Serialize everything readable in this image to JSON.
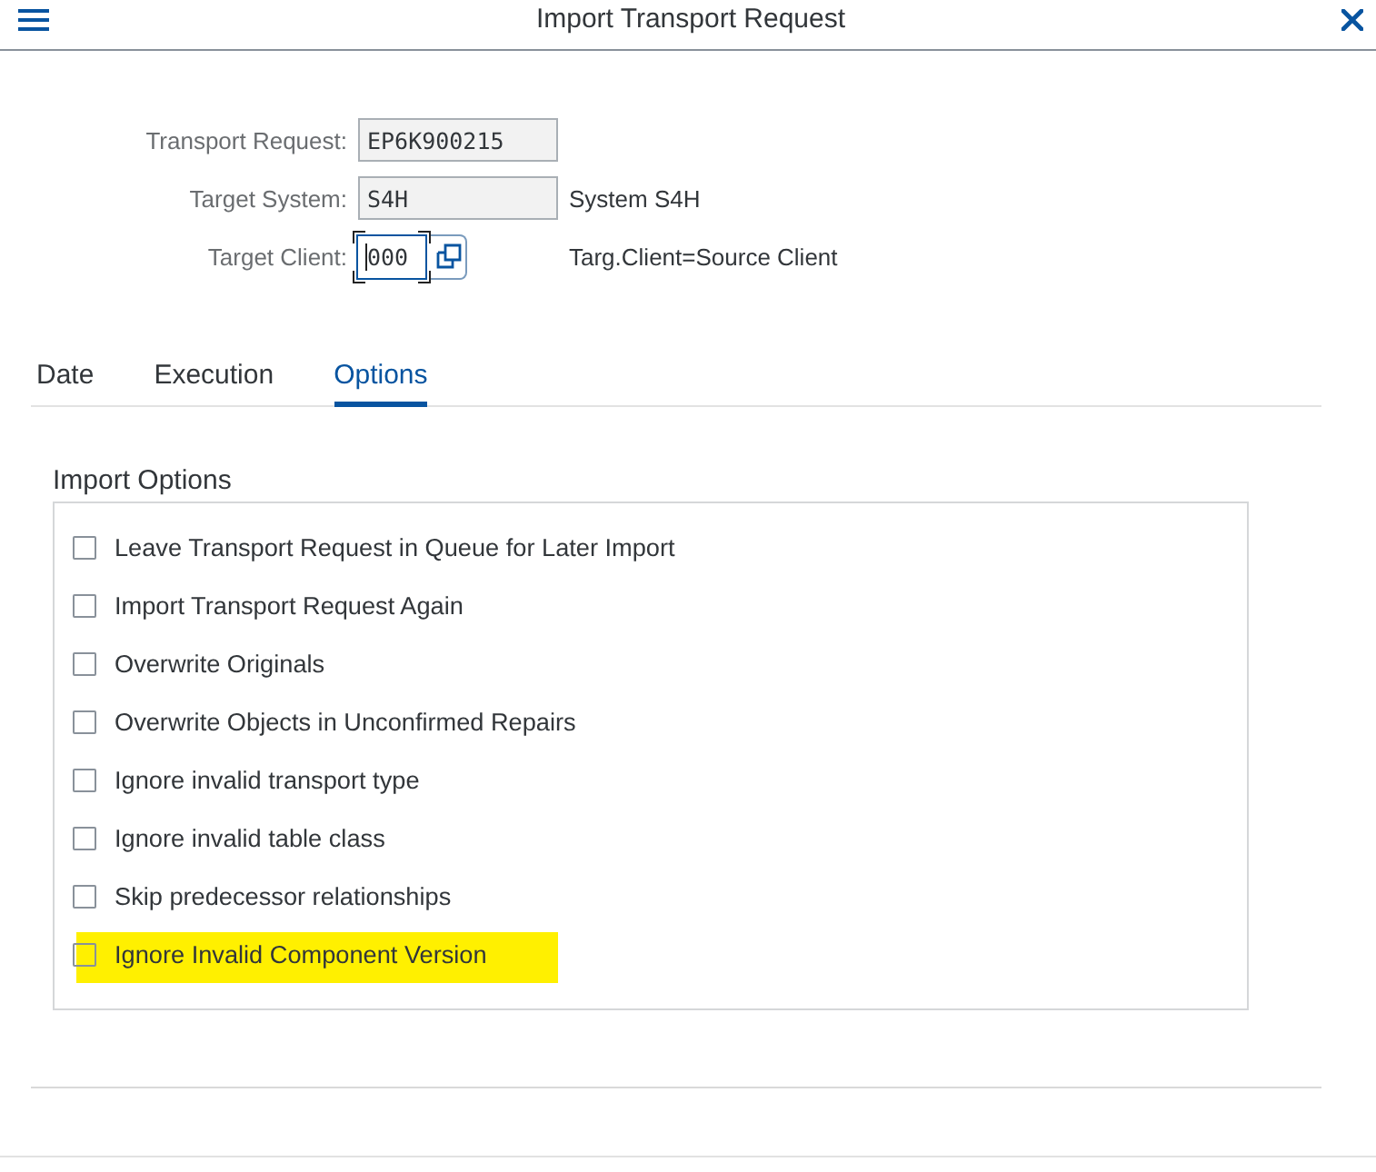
{
  "header": {
    "title": "Import Transport Request"
  },
  "form": {
    "fields": [
      {
        "label": "Transport Request:",
        "kind": "display",
        "value": "EP6K900215"
      },
      {
        "label": "Target System:",
        "kind": "display",
        "value": "S4H",
        "description": "System S4H"
      },
      {
        "label": "Target Client:",
        "kind": "value_help",
        "value": "000",
        "focused": true,
        "description": "Targ.Client=Source Client"
      }
    ]
  },
  "tabs": [
    {
      "label": "Date",
      "selected": false
    },
    {
      "label": "Execution",
      "selected": false
    },
    {
      "label": "Options",
      "selected": true
    }
  ],
  "import_options": {
    "title": "Import Options",
    "options": [
      {
        "label": "Leave Transport Request in Queue for Later Import",
        "checked": false,
        "highlighted": false
      },
      {
        "label": "Import Transport Request Again",
        "checked": false,
        "highlighted": false
      },
      {
        "label": "Overwrite Originals",
        "checked": false,
        "highlighted": false
      },
      {
        "label": "Overwrite Objects in Unconfirmed Repairs",
        "checked": false,
        "highlighted": false
      },
      {
        "label": "Ignore invalid transport type",
        "checked": false,
        "highlighted": false
      },
      {
        "label": "Ignore invalid table class",
        "checked": false,
        "highlighted": false
      },
      {
        "label": "Skip predecessor relationships",
        "checked": false,
        "highlighted": false
      },
      {
        "label": "Ignore Invalid Component Version",
        "checked": false,
        "highlighted": true
      }
    ]
  }
}
